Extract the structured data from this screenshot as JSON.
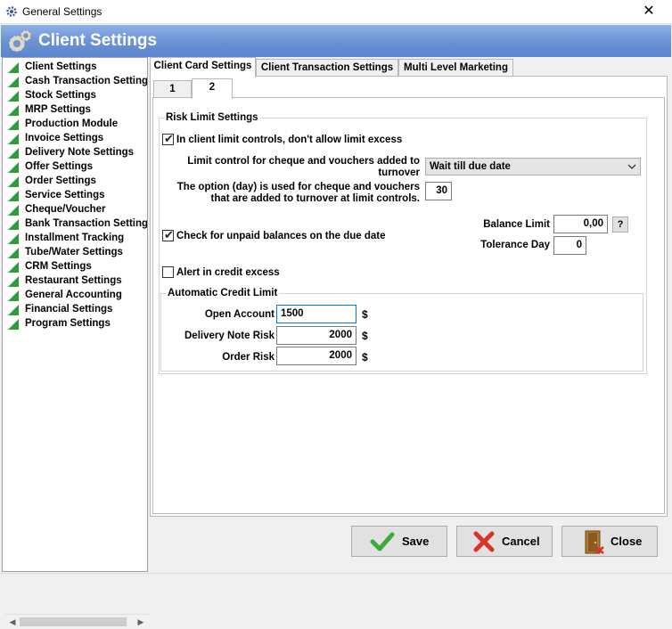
{
  "window": {
    "title": "General Settings",
    "close_glyph": "✕"
  },
  "header": {
    "title": "Client Settings",
    "color": "#6e95d6"
  },
  "sidebar": {
    "items": [
      {
        "label": "Client Settings"
      },
      {
        "label": "Cash Transaction Settings"
      },
      {
        "label": "Stock Settings"
      },
      {
        "label": "MRP Settings"
      },
      {
        "label": "Production Module"
      },
      {
        "label": "Invoice Settings"
      },
      {
        "label": "Delivery Note Settings"
      },
      {
        "label": "Offer Settings"
      },
      {
        "label": "Order Settings"
      },
      {
        "label": "Service Settings"
      },
      {
        "label": "Cheque/Voucher"
      },
      {
        "label": "Bank Transaction Settings"
      },
      {
        "label": "Installment Tracking"
      },
      {
        "label": "Tube/Water Settings"
      },
      {
        "label": "CRM Settings"
      },
      {
        "label": "Restaurant Settings"
      },
      {
        "label": "General Accounting"
      },
      {
        "label": "Financial Settings"
      },
      {
        "label": "Program Settings"
      }
    ],
    "scroll_left": "◀",
    "scroll_right": "▶"
  },
  "tabs": {
    "outer": [
      {
        "label": "Client Card Settings",
        "active": true
      },
      {
        "label": "Client Transaction Settings",
        "active": false
      },
      {
        "label": "Multi Level Marketing",
        "active": false
      }
    ],
    "inner": [
      {
        "label": "1",
        "active": false
      },
      {
        "label": "2",
        "active": true
      }
    ]
  },
  "risk": {
    "legend": "Risk Limit Settings",
    "no_limit_excess": {
      "label": "In client limit controls, don't allow limit excess",
      "checked": true
    },
    "cheque_limit_label_1": "Limit control for cheque and vouchers added to",
    "cheque_limit_label_2": "turnover",
    "cheque_limit_value": "Wait till due date",
    "option_day_label_1": "The option (day) is used for cheque and vouchers",
    "option_day_label_2": "that are added to turnover at limit controls.",
    "option_day_value": "30",
    "balance_limit_label": "Balance Limit",
    "balance_limit_value": "0,00",
    "help_label": "?",
    "unpaid_check": {
      "label": "Check for unpaid balances on the due date",
      "checked": true
    },
    "tolerance_label": "Tolerance Day",
    "tolerance_value": "0",
    "alert_credit": {
      "label": "Alert in credit excess",
      "checked": false
    }
  },
  "auto_credit": {
    "legend": "Automatic Credit Limit",
    "rows": [
      {
        "label": "Open Account",
        "value": "1500",
        "unit": "$"
      },
      {
        "label": "Delivery Note Risk",
        "value": "2000",
        "unit": "$"
      },
      {
        "label": "Order Risk",
        "value": "2000",
        "unit": "$"
      }
    ]
  },
  "buttons": {
    "save": "Save",
    "cancel": "Cancel",
    "close": "Close"
  },
  "icons": {
    "app": "gear-icon",
    "header": "gears-icon",
    "sidebar_item": "green-triangle-icon",
    "save": "check-icon",
    "cancel": "x-icon",
    "close": "door-exit-icon",
    "dropdown": "chevron-down-icon"
  },
  "colors": {
    "accent": "#0078d7",
    "tri_green": "#2e9b3e",
    "check_green": "#3cab3c",
    "cancel_red": "#d9322a"
  }
}
